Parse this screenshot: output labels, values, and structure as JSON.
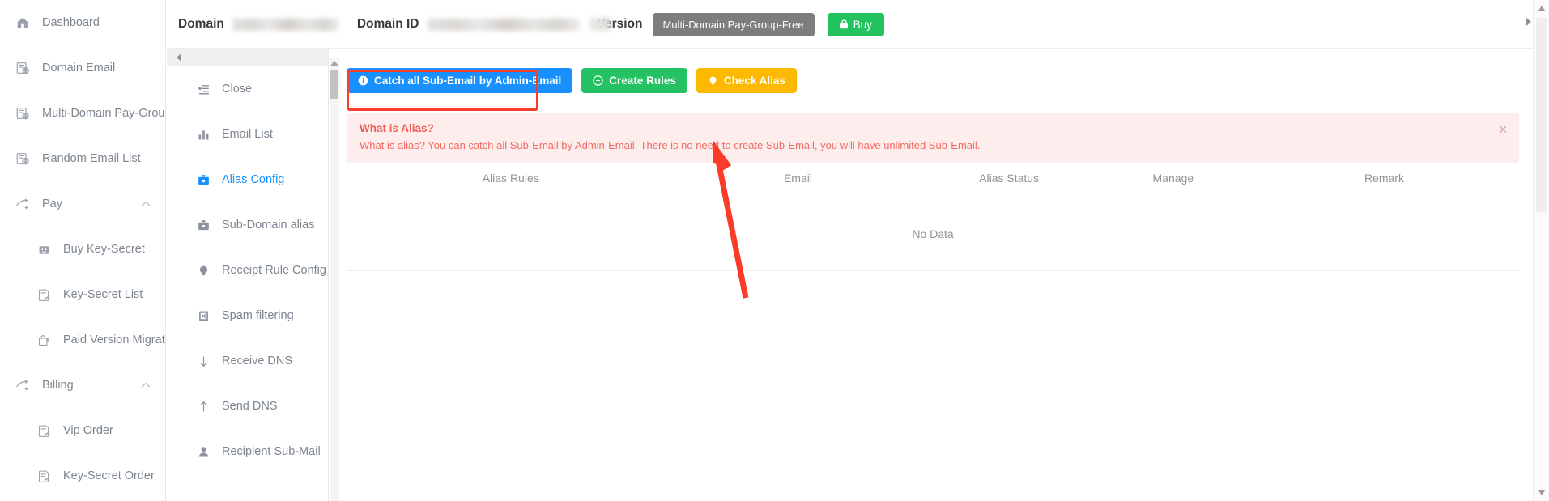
{
  "sidebar": {
    "items": [
      {
        "label": "Dashboard",
        "icon": "home-icon",
        "level": 1,
        "caret": false
      },
      {
        "label": "Domain Email",
        "icon": "domain-email-icon",
        "level": 1,
        "caret": false
      },
      {
        "label": "Multi-Domain Pay-Group",
        "icon": "domain-email-icon",
        "level": 1,
        "caret": false
      },
      {
        "label": "Random Email List",
        "icon": "domain-email-icon",
        "level": 1,
        "caret": false
      },
      {
        "label": "Pay",
        "icon": "pay-icon",
        "level": 1,
        "caret": true
      },
      {
        "label": "Buy Key-Secret",
        "icon": "buy-key-icon",
        "level": 2,
        "caret": false
      },
      {
        "label": "Key-Secret List",
        "icon": "list-icon",
        "level": 2,
        "caret": false
      },
      {
        "label": "Paid Version Migration",
        "icon": "migration-icon",
        "level": 2,
        "caret": false
      },
      {
        "label": "Billing",
        "icon": "pay-icon",
        "level": 1,
        "caret": true
      },
      {
        "label": "Vip Order",
        "icon": "list-icon",
        "level": 2,
        "caret": false
      },
      {
        "label": "Key-Secret Order",
        "icon": "list-icon",
        "level": 2,
        "caret": false
      }
    ]
  },
  "submenu": {
    "collapse_icon": "collapse-left-icon",
    "items": [
      {
        "label": "Close",
        "icon": "close-list-icon",
        "active": false
      },
      {
        "label": "Email List",
        "icon": "bar-chart-icon",
        "active": false
      },
      {
        "label": "Alias Config",
        "icon": "briefcase-icon",
        "active": true
      },
      {
        "label": "Sub-Domain alias",
        "icon": "briefcase-icon",
        "active": false
      },
      {
        "label": "Receipt Rule Config",
        "icon": "bulb-icon",
        "active": false
      },
      {
        "label": "Spam filtering",
        "icon": "spam-icon",
        "active": false
      },
      {
        "label": "Receive DNS",
        "icon": "arrow-down-icon",
        "active": false
      },
      {
        "label": "Send DNS",
        "icon": "arrow-up-icon",
        "active": false
      },
      {
        "label": "Recipient Sub-Mail",
        "icon": "user-icon",
        "active": false
      }
    ]
  },
  "header": {
    "domain_label": "Domain",
    "domain_value": "",
    "domain_id_label": "Domain ID",
    "domain_id_value": "",
    "version_label": "Version",
    "version_badge": "Multi-Domain Pay-Group-Free",
    "buy_label": "Buy",
    "buy_icon": "lock-icon",
    "badge_color": "#7d7d7d",
    "buy_color": "#22c35e"
  },
  "toolbar": {
    "catch_all_label": "Catch all Sub-Email by Admin-Email",
    "catch_all_icon": "info-circle-icon",
    "catch_all_color": "#1890ff",
    "create_rules_label": "Create Rules",
    "create_rules_icon": "plus-circle-icon",
    "create_rules_color": "#24c263",
    "check_alias_label": "Check Alias",
    "check_alias_icon": "bulb-icon",
    "check_alias_color": "#fcb900"
  },
  "annotation": {
    "highlight_color": "#fa3c29",
    "arrow_color": "#fa3c29"
  },
  "alert": {
    "title": "What is Alias?",
    "description": "What is alias? You can catch all Sub-Email by Admin-Email. There is no need to create Sub-Email, you will have unlimited Sub-Email.",
    "close_icon": "close-icon",
    "background": "#fdeeed",
    "text_color": "#f05b54"
  },
  "table": {
    "columns": [
      "Alias Rules",
      "Email",
      "Alias Status",
      "Manage",
      "Remark"
    ],
    "rows": [],
    "empty_text": "No Data"
  },
  "scrollbars": {
    "inner_up_icon": "scroll-up-icon",
    "outer_up_icon": "scroll-up-icon",
    "outer_down_icon": "scroll-down-icon"
  }
}
